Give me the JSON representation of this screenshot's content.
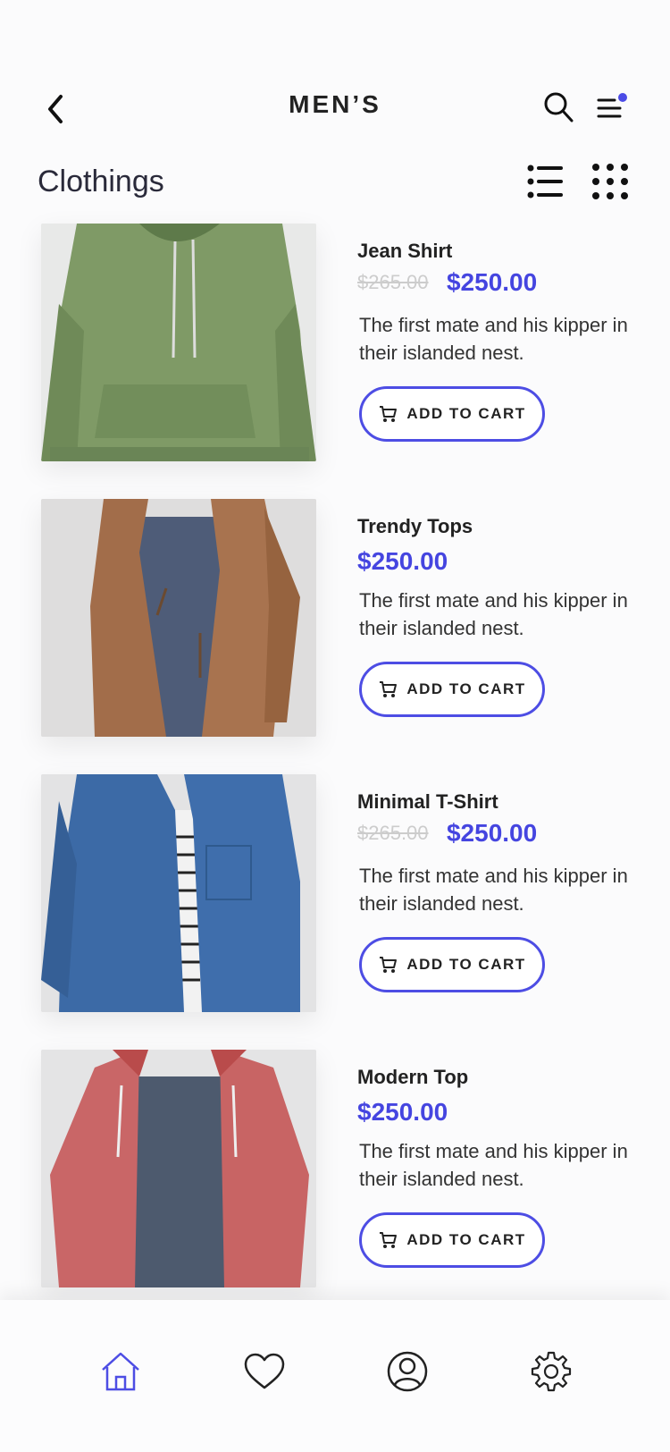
{
  "header": {
    "title": "MEN’S"
  },
  "section": {
    "title": "Clothings"
  },
  "products": [
    {
      "name": "Jean Shirt",
      "old_price": "$265.00",
      "price": "$250.00",
      "description": "The first mate and his kipper in their islanded nest.",
      "cart_label": "ADD TO CART",
      "image": "green hoodie"
    },
    {
      "name": "Trendy Tops",
      "old_price": "",
      "price": "$250.00",
      "description": "The first mate and his kipper in their islanded nest.",
      "cart_label": "ADD TO CART",
      "image": "brown suede jacket"
    },
    {
      "name": "Minimal T-Shirt",
      "old_price": "$265.00",
      "price": "$250.00",
      "description": "The first mate and his kipper in their islanded nest.",
      "cart_label": "ADD TO CART",
      "image": "blue denim jacket"
    },
    {
      "name": "Modern Top",
      "old_price": "",
      "price": "$250.00",
      "description": "The first mate and his kipper in their islanded nest.",
      "cart_label": "ADD TO CART",
      "image": "red zip hoodie"
    }
  ],
  "bottom_nav": {
    "items": [
      "home-icon",
      "heart-icon",
      "profile-icon",
      "settings-icon"
    ],
    "active": "home-icon"
  },
  "colors": {
    "accent": "#4545e0",
    "notification": "#4b4be6",
    "old_price": "#cccccc"
  }
}
